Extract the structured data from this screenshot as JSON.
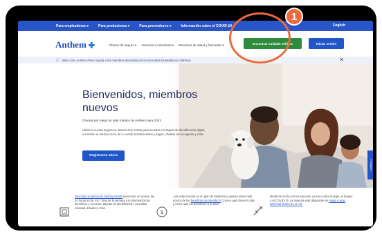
{
  "topbar": {
    "items": [
      "Para empleadores ▾",
      "Para productores ▾",
      "Para proveedores ▾",
      "Información sobre el COVID-19"
    ],
    "language": "English"
  },
  "header": {
    "logo": "Anthem",
    "nav": [
      "Planes de seguro ▾",
      "Atención a miembros ▾",
      "Recursos de salud y bienestar ▾"
    ],
    "find_care": "Encontrar cuidado médico",
    "login": "Iniciar sesión",
    "marker_number": "1"
  },
  "banner": {
    "info_icon": "info-icon",
    "text": "Mira cómo Anthem ofrece ayuda a los miembros afectados por los incendios forestales en California",
    "close": "✕"
  },
  "hero": {
    "title": "Bienvenidos, miembros nuevos",
    "subtitle": "Gracias por elegir un plan médico de Anthem para 2022.",
    "body": "Utiliza tu cuenta segura en Internet hoy mismo para acceder a tu tarjeta de identificación digital, encontrar un médico cerca de ti, revisar reclamaciones y pagos, chatear con un agente y más!",
    "register": "Registrarse ahora",
    "feedback": "Feedback"
  },
  "strip": {
    "col1": {
      "title": "Descarga la aplicación Sydney Health",
      "body": "para tener un acceso las 24 horas al día, los 7 días de la semana a tu información de beneficios y recursos, tarjetas de identificación, consultas médicas virtuales y más."
    },
    "col2": {
      "pre": "¿Ya estás inscrito en un plan de Medicare y quieres saber más acerca de tus",
      "link": "beneficios de miembro?",
      "post": "Conoce qué ofrece tu plan y cómo usar tus beneficios a tu favor."
    },
    "col3": {
      "pre": "Mantente al día con tus vacunas, ya sea contra la gripe, el herpes o el COVID-19. La mayoría está disponible sin",
      "link": "ningún cargo adicional dentro de tu red."
    }
  },
  "colors": {
    "topbar": "#2a55c6",
    "find_care": "#2e8b3e",
    "login": "#2156c8",
    "marker": "#ee6a3c",
    "title": "#1f2a60"
  }
}
